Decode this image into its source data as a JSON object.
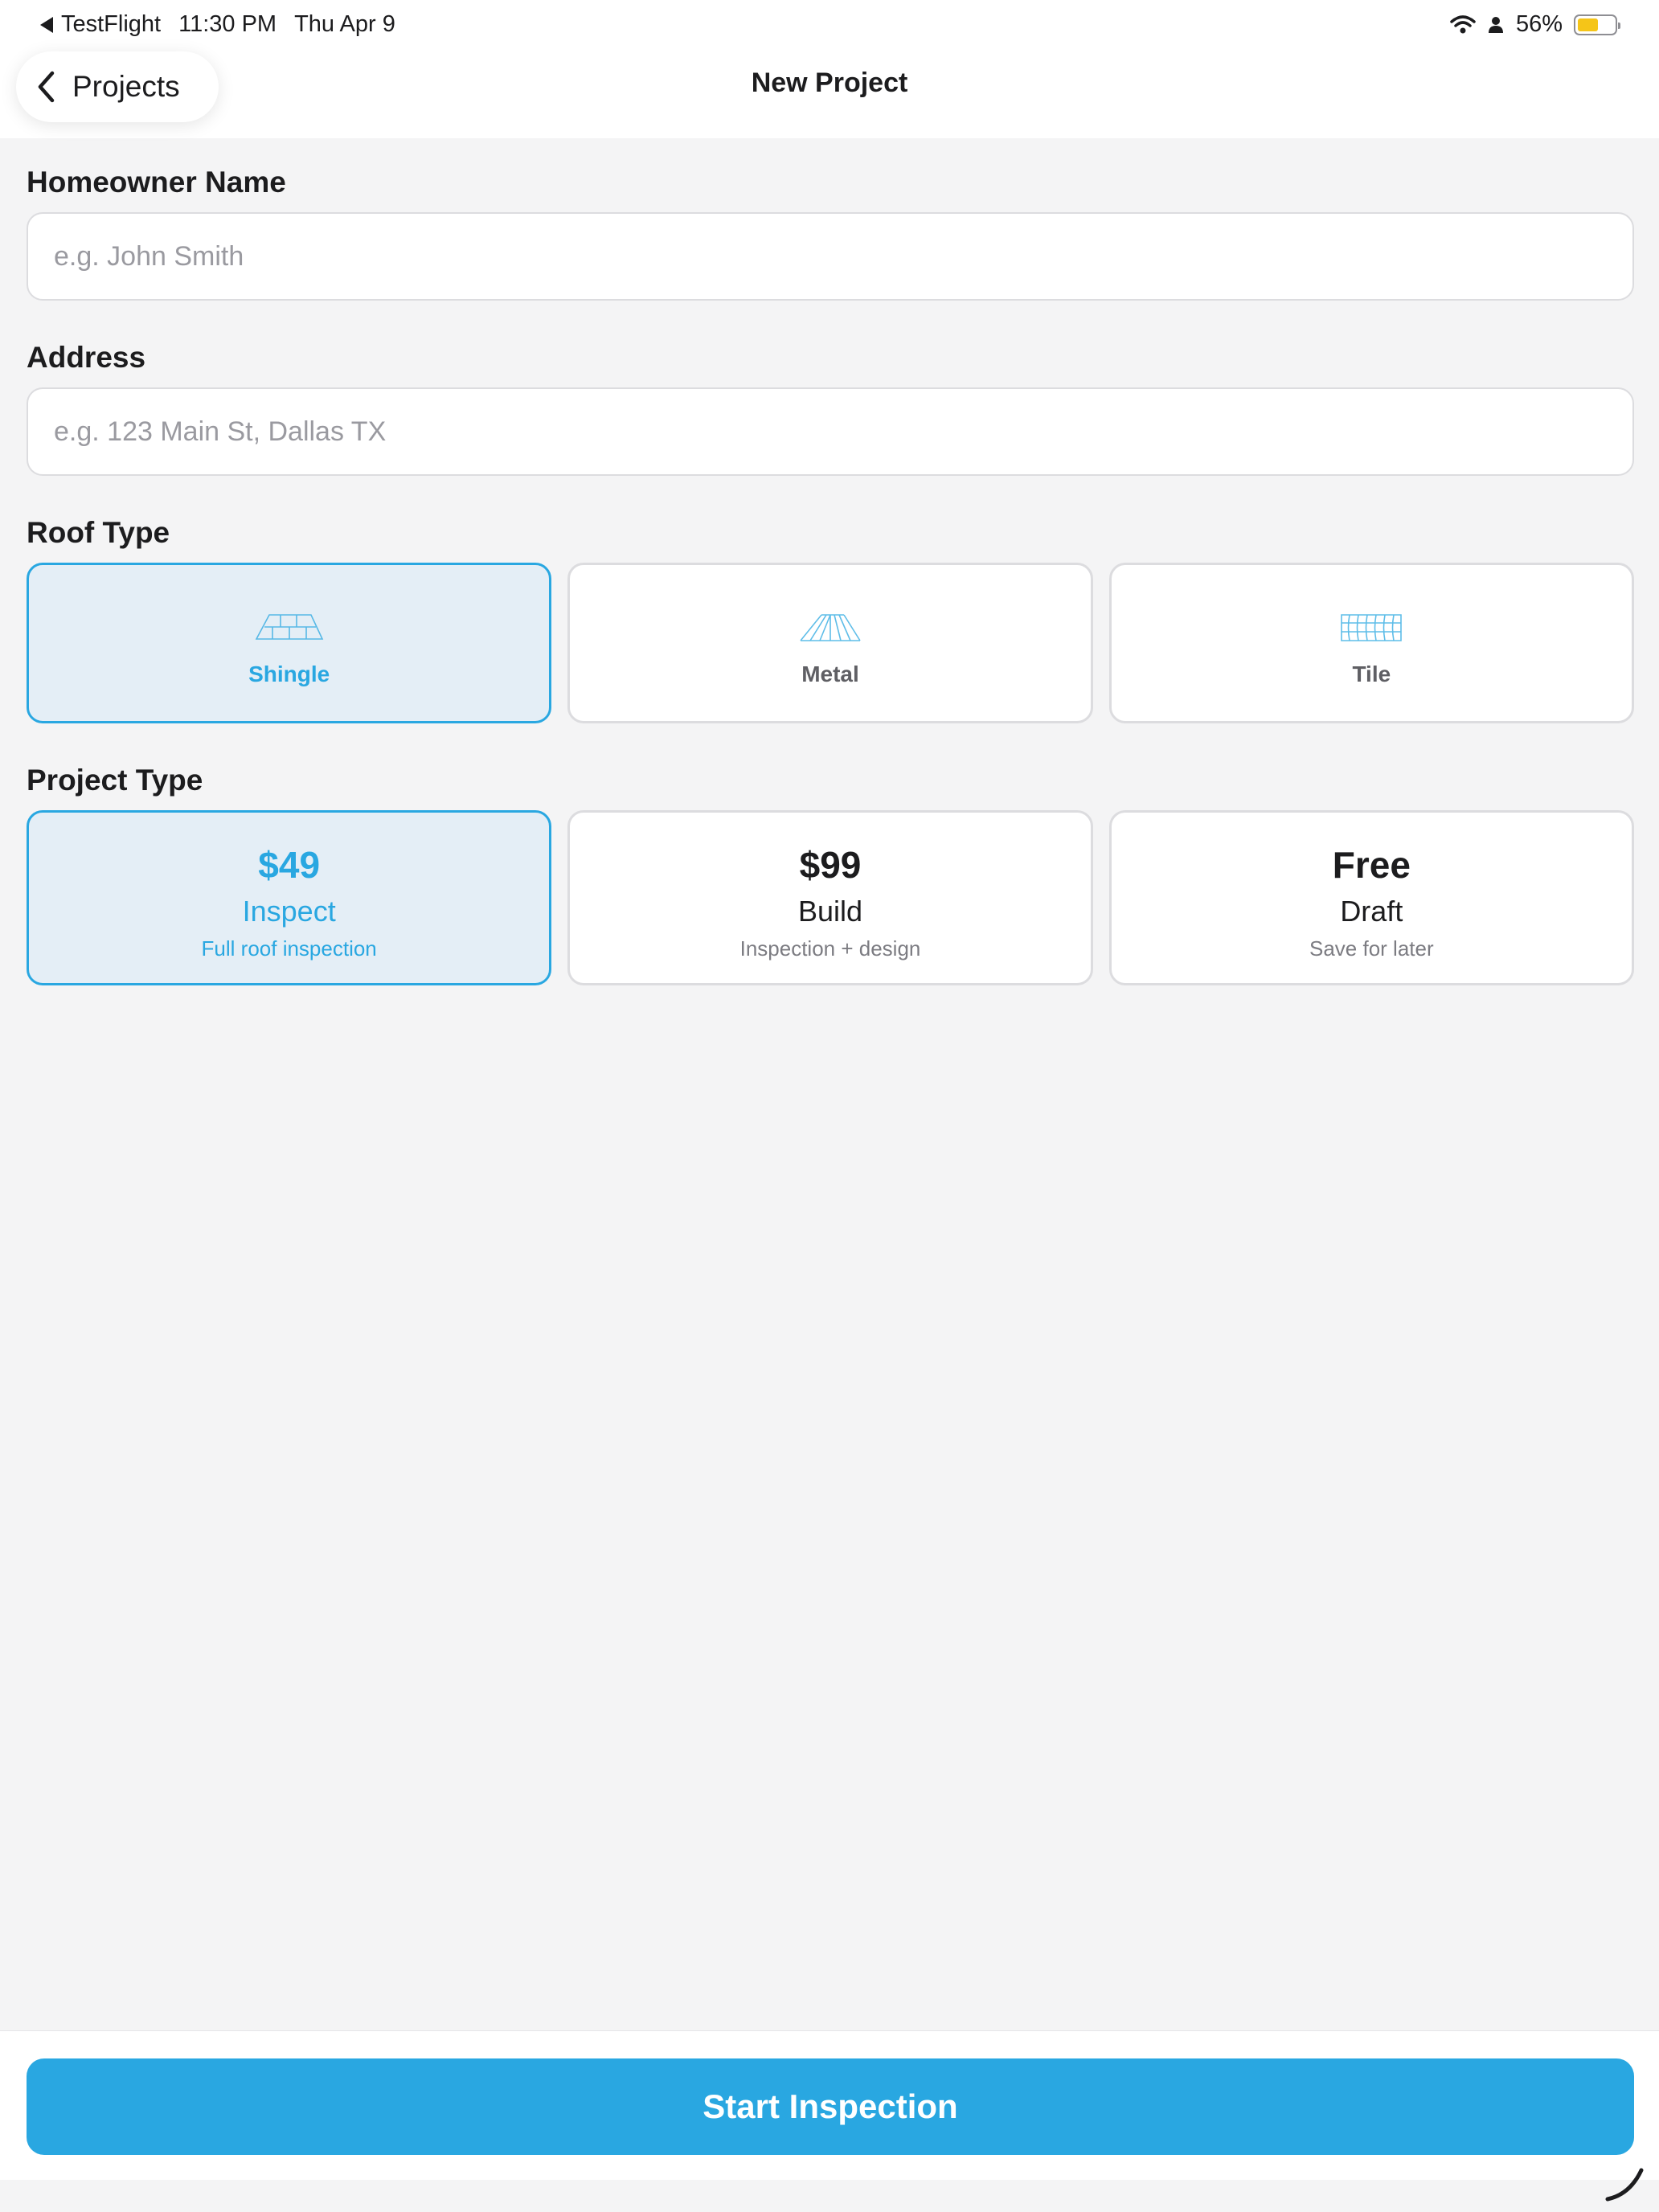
{
  "status_bar": {
    "back_app": "TestFlight",
    "time": "11:30 PM",
    "date": "Thu Apr 9",
    "battery_percent": "56%",
    "battery_level": 0.56,
    "battery_color": "#f5c518",
    "icons": [
      "back-triangle-icon",
      "wifi-icon",
      "person-icon",
      "battery-icon"
    ]
  },
  "nav": {
    "back_label": "Projects",
    "back_icon": "chevron-left-icon",
    "title": "New Project"
  },
  "form": {
    "homeowner": {
      "label": "Homeowner Name",
      "value": "",
      "placeholder": "e.g. John Smith"
    },
    "address": {
      "label": "Address",
      "value": "",
      "placeholder": "e.g. 123 Main St, Dallas TX"
    },
    "roof_type": {
      "label": "Roof Type",
      "selected": "Shingle",
      "options": [
        {
          "label": "Shingle",
          "icon": "shingle-roof-icon"
        },
        {
          "label": "Metal",
          "icon": "metal-roof-icon"
        },
        {
          "label": "Tile",
          "icon": "tile-roof-icon"
        }
      ]
    },
    "project_type": {
      "label": "Project Type",
      "selected": "Inspect",
      "options": [
        {
          "price": "$49",
          "name": "Inspect",
          "description": "Full roof inspection"
        },
        {
          "price": "$99",
          "name": "Build",
          "description": "Inspection + design"
        },
        {
          "price": "Free",
          "name": "Draft",
          "description": "Save for later"
        }
      ]
    }
  },
  "footer": {
    "primary_button": "Start Inspection"
  },
  "colors": {
    "accent": "#29a7e1",
    "selected_background": "#e4eef6",
    "page_background": "#f4f4f5"
  }
}
